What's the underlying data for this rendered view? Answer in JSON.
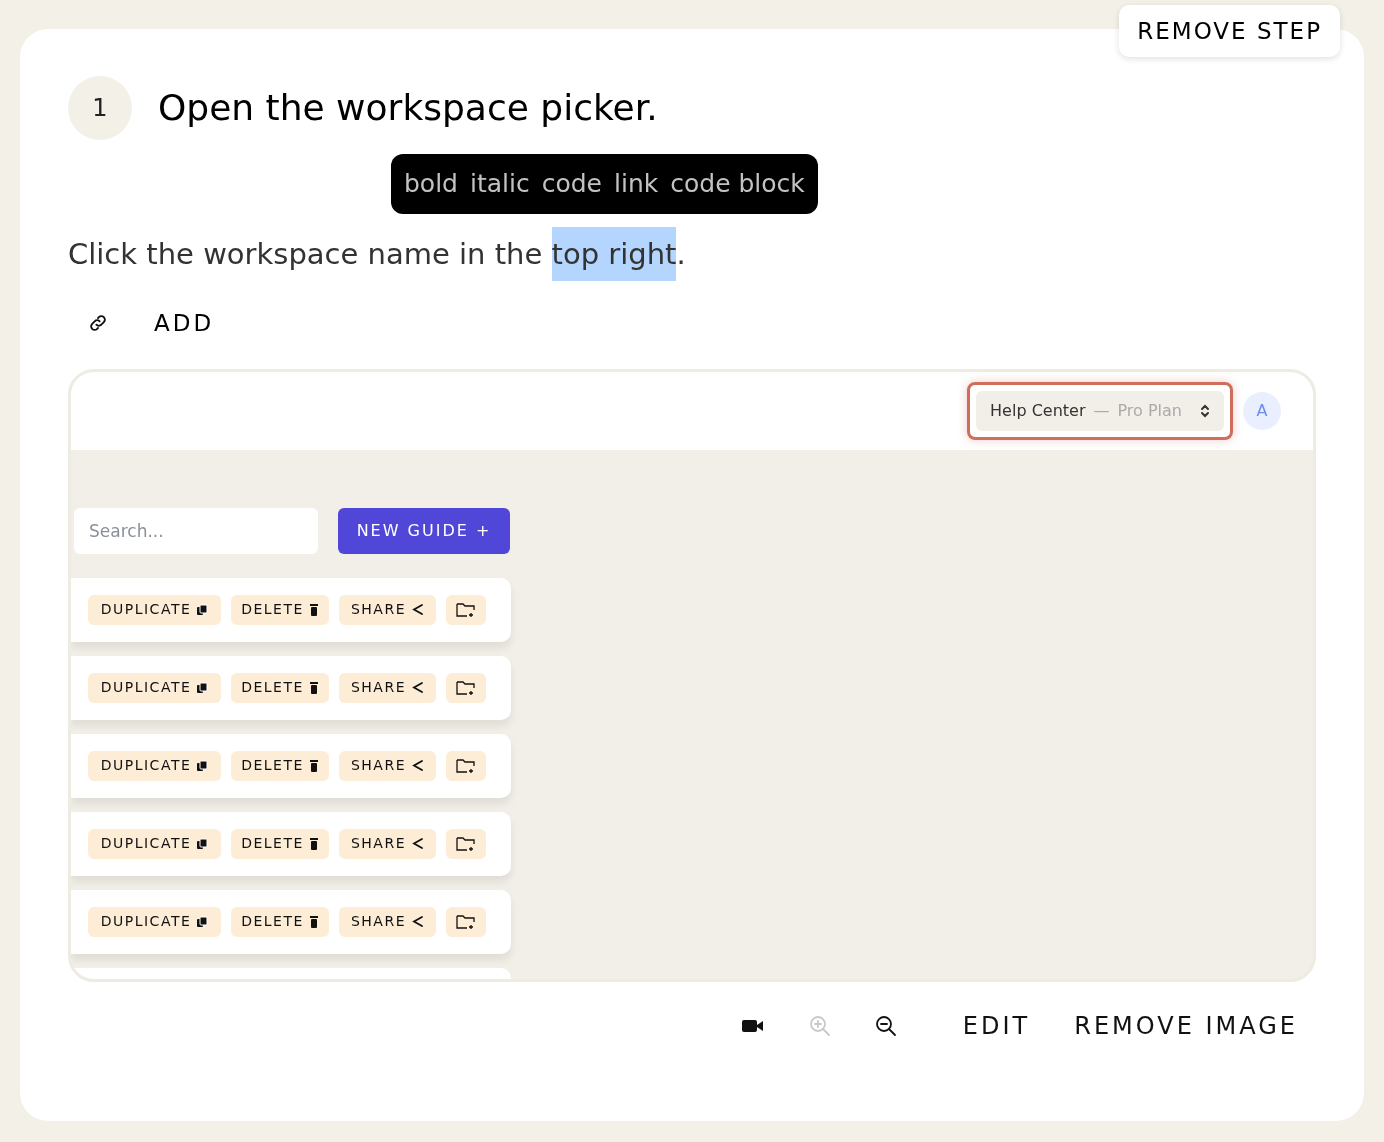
{
  "remove_step": "REMOVE STEP",
  "step": {
    "number": "1",
    "title": "Open the workspace picker."
  },
  "format_toolbar": [
    "bold",
    "italic",
    "code",
    "link",
    "code block"
  ],
  "instruction": [
    {
      "text": "Click the workspace name in the ",
      "selected": false
    },
    {
      "text": "top right",
      "selected": true
    },
    {
      "text": ".",
      "selected": false
    }
  ],
  "add_link": {
    "label": "ADD"
  },
  "screenshot": {
    "workspace": {
      "name": "Help Center",
      "separator": "—",
      "plan": "Pro Plan"
    },
    "avatar": "A",
    "search": {
      "placeholder": "Search..."
    },
    "new_guide": "NEW GUIDE +",
    "rows": [
      {
        "actions": [
          "DUPLICATE",
          "DELETE",
          "SHARE"
        ]
      },
      {
        "actions": [
          "DUPLICATE",
          "DELETE",
          "SHARE"
        ]
      },
      {
        "actions": [
          "DUPLICATE",
          "DELETE",
          "SHARE"
        ]
      },
      {
        "actions": [
          "DUPLICATE",
          "DELETE",
          "SHARE"
        ]
      },
      {
        "actions": [
          "DUPLICATE",
          "DELETE",
          "SHARE"
        ]
      }
    ]
  },
  "image_toolbar": [
    {
      "kind": "video",
      "disabled": false
    },
    {
      "kind": "zoom_in",
      "disabled": true
    },
    {
      "kind": "zoom_out",
      "disabled": false
    },
    {
      "kind": "text",
      "label": "EDIT",
      "disabled": false
    },
    {
      "kind": "text",
      "label": "REMOVE IMAGE",
      "disabled": false
    }
  ]
}
